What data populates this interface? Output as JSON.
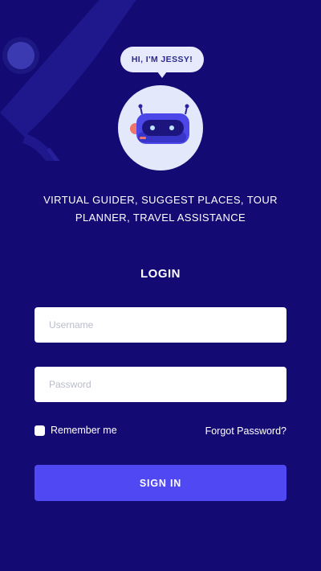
{
  "assistant": {
    "greeting": "HI, I'M JESSY!",
    "avatar_icon": "robot-icon",
    "tagline_line1": "VIRTUAL GUIDER, SUGGEST PLACES, TOUR",
    "tagline_line2": "PLANNER, TRAVEL ASSISTANCE"
  },
  "login": {
    "title": "LOGIN",
    "username_placeholder": "Username",
    "username_value": "",
    "password_placeholder": "Password",
    "password_value": "",
    "remember_label": "Remember me",
    "remember_checked": false,
    "forgot_label": "Forgot Password?",
    "signin_label": "SIGN IN"
  },
  "colors": {
    "background": "#130b73",
    "accent": "#5048f2",
    "bubble": "#e7eafc",
    "robot_body": "#4b47e8"
  }
}
